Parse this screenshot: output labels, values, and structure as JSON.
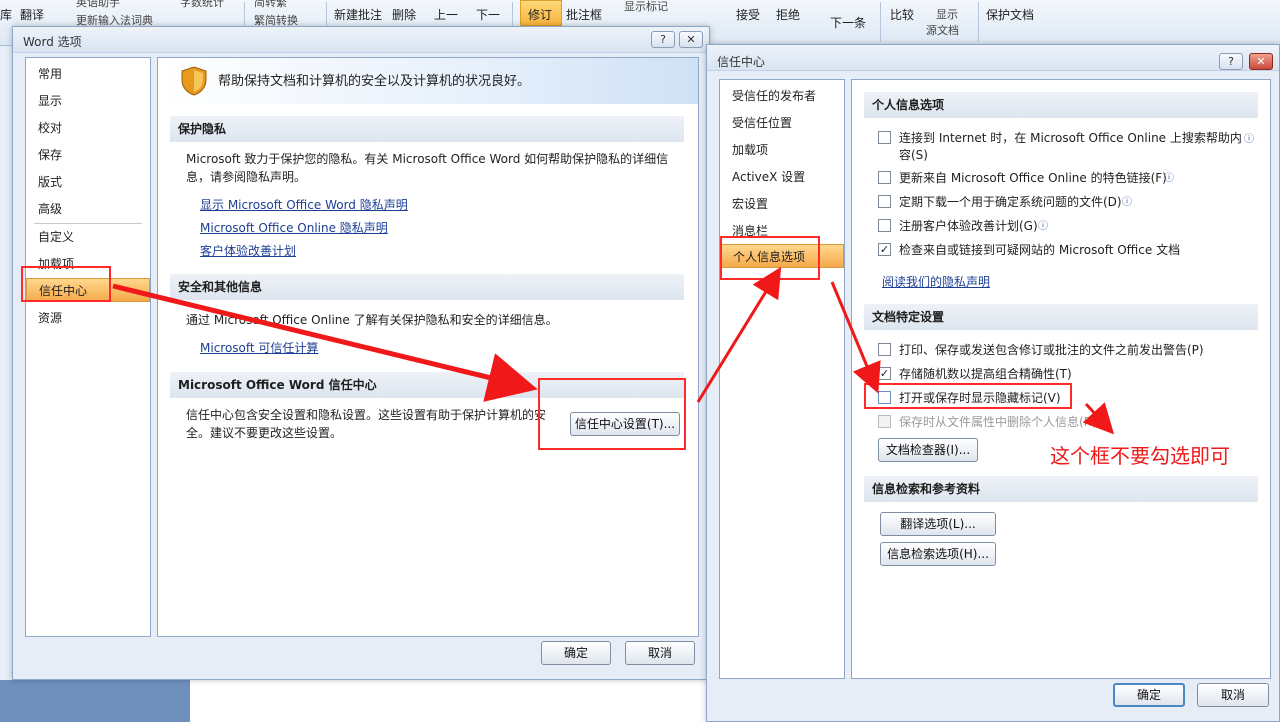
{
  "ribbon": {
    "items": [
      "库",
      "翻译",
      "英语助手",
      "更新输入法词典",
      "字数统计",
      "简转繁",
      "繁简转换",
      "新建批注",
      "删除",
      "上一",
      "下一",
      "修订",
      "批注框",
      "显示标记",
      "接受",
      "拒绝",
      "下一条",
      "比较",
      "显示",
      "源文档",
      "保护文档"
    ]
  },
  "word_options": {
    "title": "Word 选项",
    "help_btn": "?",
    "close_btn": "✕",
    "nav": [
      "常用",
      "显示",
      "校对",
      "保存",
      "版式",
      "高级",
      "自定义",
      "加载项",
      "信任中心",
      "资源"
    ],
    "banner": "帮助保持文档和计算机的安全以及计算机的状况良好。",
    "privacy": {
      "head": "保护隐私",
      "text": "Microsoft 致力于保护您的隐私。有关 Microsoft Office Word 如何帮助保护隐私的详细信息，请参阅隐私声明。",
      "links": [
        "显示 Microsoft Office Word 隐私声明",
        "Microsoft Office Online 隐私声明",
        "客户体验改善计划"
      ]
    },
    "security": {
      "head": "安全和其他信息",
      "text": "通过 Microsoft Office Online 了解有关保护隐私和安全的详细信息。",
      "link": "Microsoft 可信任计算"
    },
    "trust": {
      "head": "Microsoft Office Word 信任中心",
      "text": "信任中心包含安全设置和隐私设置。这些设置有助于保护计算机的安全。建议不要更改这些设置。",
      "button": "信任中心设置(T)..."
    },
    "ok": "确定",
    "cancel": "取消"
  },
  "trust_center": {
    "title": "信任中心",
    "help_btn": "?",
    "close_btn": "✕",
    "nav": [
      "受信任的发布者",
      "受信任位置",
      "加载项",
      "ActiveX 设置",
      "宏设置",
      "消息栏",
      "个人信息选项"
    ],
    "personal": {
      "head": "个人信息选项",
      "options": [
        {
          "label": "连接到 Internet 时，在 Microsoft Office Online 上搜索帮助内容(S)",
          "checked": false
        },
        {
          "label": "更新来自 Microsoft Office Online 的特色链接(F)",
          "checked": false
        },
        {
          "label": "定期下载一个用于确定系统问题的文件(D)",
          "checked": false
        },
        {
          "label": "注册客户体验改善计划(G)",
          "checked": false
        },
        {
          "label": "检查来自或链接到可疑网站的 Microsoft Office 文档",
          "checked": true
        }
      ],
      "link": "阅读我们的隐私声明"
    },
    "doc": {
      "head": "文档特定设置",
      "options": [
        {
          "label": "打印、保存或发送包含修订或批注的文件之前发出警告(P)",
          "checked": false
        },
        {
          "label": "存储随机数以提高组合精确性(T)",
          "checked": true
        },
        {
          "label": "打开或保存时显示隐藏标记(V)",
          "checked": false
        },
        {
          "label": "保存时从文件属性中删除个人信息(R)",
          "checked": false,
          "disabled": true
        }
      ],
      "button": "文档检查器(I)..."
    },
    "research": {
      "head": "信息检索和参考资料",
      "buttons": [
        "翻译选项(L)...",
        "信息检索选项(H)..."
      ]
    },
    "ok": "确定",
    "cancel": "取消"
  },
  "annotation": {
    "note": "这个框不要勾选即可",
    "color": "#f01818"
  },
  "icons": {
    "info": "ⓘ",
    "check": "✓",
    "shield": "shield-icon"
  }
}
